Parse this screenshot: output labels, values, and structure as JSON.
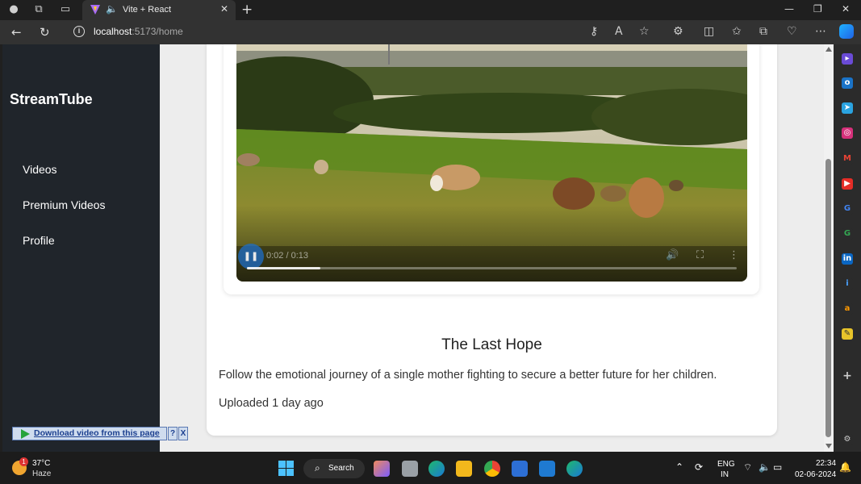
{
  "browser": {
    "tab_title": "Vite + React",
    "url_host": "localhost",
    "url_path": ":5173/home"
  },
  "sidebar": {
    "brand": "StreamTube",
    "items": [
      {
        "label": "Videos"
      },
      {
        "label": "Premium Videos"
      },
      {
        "label": "Profile"
      }
    ]
  },
  "video": {
    "time": "0:02 / 0:13",
    "progress": 0.15,
    "title": "The Last Hope",
    "description": "Follow the emotional journey of a single mother fighting to secure a better future for her children.",
    "uploaded": "Uploaded 1 day ago"
  },
  "downloader": {
    "label": "Download video from this page",
    "help": "?",
    "close": "X"
  },
  "taskbar": {
    "temperature": "37°C",
    "condition": "Haze",
    "weather_badge": "1",
    "search_label": "Search",
    "lang_line1": "ENG",
    "lang_line2": "IN",
    "time": "22:34",
    "date": "02-06-2024"
  },
  "colors": {
    "sidebar_bg": "#20252b",
    "page_bg": "#ededed",
    "accent_blue": "#4cc2ff"
  },
  "icons": [
    "profile-icon",
    "workspaces-icon",
    "tab-actions-icon",
    "back-icon",
    "refresh-icon",
    "info-icon",
    "read-aloud-icon",
    "favorite-star-icon",
    "extensions-icon",
    "split-screen-icon",
    "favorites-icon",
    "collections-icon",
    "performance-icon",
    "more-icon",
    "copilot-icon",
    "pause-icon",
    "volume-icon",
    "fullscreen-icon",
    "video-more-icon",
    "windows-start-icon",
    "search-icon",
    "wifi-icon",
    "speaker-icon",
    "battery-icon",
    "notification-bell-icon"
  ]
}
